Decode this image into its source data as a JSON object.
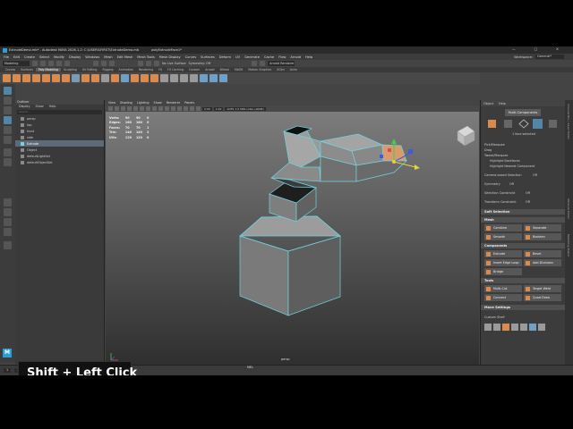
{
  "window": {
    "title": "ExtrudeDemo.mb* - Autodesk MAYA 2026.1.2: C:\\USERS\\FIRST\\ExtrudeDemo.mb",
    "object_label": "polyExtrudeFace1*",
    "controls": [
      "—",
      "□",
      "✕"
    ]
  },
  "menubar": {
    "items": [
      "File",
      "Edit",
      "Create",
      "Select",
      "Modify",
      "Display",
      "Windows",
      "Mesh",
      "Edit Mesh",
      "Mesh Tools",
      "Mesh Display",
      "Curves",
      "Surfaces",
      "Deform",
      "UV",
      "Generate",
      "Cache",
      "Flow",
      "Arnold",
      "Help"
    ],
    "workspace_label": "Workspace:",
    "workspace_value": "General*"
  },
  "statusline": {
    "mode": "Modeling",
    "symmetry": "No Live Surface",
    "symmetry2": "Symmetry: Off",
    "renderer": "Arnold Renderer"
  },
  "shelf_tabs": [
    "Curves",
    "Surfaces",
    "Poly Modeling",
    "Sculpting",
    "UV Editing",
    "Rigging",
    "Animation",
    "Rendering",
    "FX",
    "FX Caching",
    "Custom",
    "Arnold",
    "Bifrost",
    "MASH",
    "Motion Graphics",
    "XGen",
    "Anim"
  ],
  "shelf_active": "Poly Modeling",
  "outliner": {
    "title": "Outliner",
    "menu": [
      "Display",
      "Show",
      "Help"
    ],
    "search_placeholder": "Search...",
    "items": [
      {
        "label": "persp",
        "selected": false
      },
      {
        "label": "top",
        "selected": false
      },
      {
        "label": "front",
        "selected": false
      },
      {
        "label": "side",
        "selected": false
      },
      {
        "label": "Extrude",
        "selected": true
      },
      {
        "label": "Object",
        "selected": false
      },
      {
        "label": "defaultLightSet",
        "selected": false
      },
      {
        "label": "defaultObjectSet",
        "selected": false
      }
    ]
  },
  "viewport": {
    "menu": [
      "View",
      "Shading",
      "Lighting",
      "Show",
      "Renderer",
      "Panels"
    ],
    "field_a": "0.00",
    "field_b": "1.00",
    "color_space": "ACES 1.0 SDR-video (sRGB)",
    "camera": "persp",
    "hud": [
      [
        "Verts:",
        "90",
        "90",
        "0"
      ],
      [
        "Edges:",
        "160",
        "160",
        "0"
      ],
      [
        "Faces:",
        "70",
        "70",
        "1"
      ],
      [
        "Tris:",
        "140",
        "140",
        "2"
      ],
      [
        "UVs:",
        "120",
        "120",
        "0"
      ]
    ]
  },
  "attribute_panel": {
    "tabs": [
      "Object",
      "Help"
    ],
    "multi_components": "Multi-Components",
    "status": "1 face selected",
    "options": [
      "Pick/Marquee",
      "Drag",
      "Tweak/Marquee"
    ],
    "checkboxes": [
      "Highlight Backfaces",
      "Highlight Nearest Component"
    ],
    "fields": [
      [
        "Camera-based Selection",
        "Off"
      ],
      [
        "Symmetry",
        "Off"
      ],
      [
        "Selection Constraint",
        "Off"
      ],
      [
        "Transform Constraint",
        "Off"
      ]
    ],
    "soft_selection": "Soft Selection",
    "mesh_section": "Mesh",
    "mesh_buttons": [
      "Combine",
      "Separate",
      "Smooth",
      "Boolean"
    ],
    "components_section": "Components",
    "component_buttons": [
      "Extrude",
      "Bevel",
      "Bridge",
      "Add Divisions",
      "Bridge"
    ],
    "component_buttons_display": [
      "Extrude",
      "Bevel",
      "Insert Edge Loop",
      "Add Divisions",
      "Bridge"
    ],
    "tools_section": "Tools",
    "tool_buttons": [
      "Multi-Cut",
      "Target Weld",
      "Connect",
      "Quad Draw"
    ],
    "move_settings": "Move Settings",
    "custom_shelf": "Custom Shelf"
  },
  "right_strip": [
    "Channel Box / Layer Editor",
    "Attribute Editor",
    "Modelling Toolkit"
  ],
  "timeline": {
    "start": "1",
    "end": "120",
    "fps": "24 fps",
    "label": "MEL"
  },
  "overlay": {
    "text": "Shift + Left Click"
  },
  "colors": {
    "selection_blue": "#5285a6",
    "wire_cyan": "#6fd3e0",
    "face_orange": "#d99a6c",
    "accent_orange": "#d98a4e"
  }
}
